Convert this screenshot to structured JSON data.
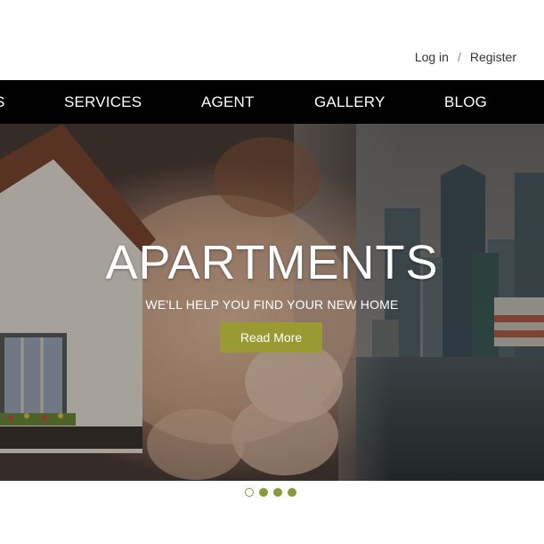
{
  "auth": {
    "login_label": "Log in",
    "separator": "/",
    "register_label": "Register"
  },
  "nav": {
    "items": [
      {
        "label": "S"
      },
      {
        "label": "SERVICES"
      },
      {
        "label": "AGENT"
      },
      {
        "label": "GALLERY"
      },
      {
        "label": "BLOG"
      }
    ]
  },
  "hero": {
    "title": "APARTMENTS",
    "subtitle": "WE'LL HELP YOU FIND YOUR NEW HOME",
    "button_label": "Read More",
    "button_color": "#9a9a33"
  },
  "slider": {
    "slide_count": 4,
    "active_index": 0,
    "dot_color": "#8a9a3a"
  }
}
